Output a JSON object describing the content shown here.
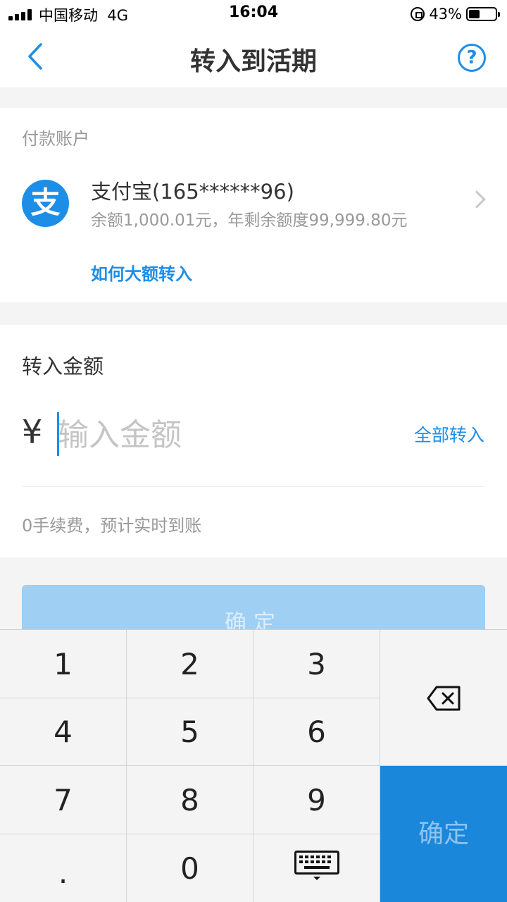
{
  "status_bar": {
    "carrier": "中国移动",
    "network": "4G",
    "time": "16:04",
    "battery_text": "43%",
    "battery_level": 0.43
  },
  "nav": {
    "title": "转入到活期",
    "help_symbol": "?"
  },
  "payment": {
    "section_label": "付款账户",
    "logo_char": "支",
    "account_name": "支付宝(165******96)",
    "balance_text": "余额1,000.01元，年剩余额度99,999.80元",
    "large_transfer_link": "如何大额转入"
  },
  "amount": {
    "section_label": "转入金额",
    "currency_symbol": "¥",
    "input_placeholder": "输入金额",
    "input_value": "",
    "transfer_all_label": "全部转入",
    "fee_note": "0手续费，预计实时到账"
  },
  "confirm_button": {
    "label": "确定"
  },
  "keyboard": {
    "keys": [
      "1",
      "2",
      "3",
      "4",
      "5",
      "6",
      "7",
      "8",
      "9",
      ".",
      "0"
    ],
    "ok_label": "确定"
  },
  "colors": {
    "accent": "#1c8ee8",
    "confirm_disabled": "#9fcff3",
    "keyboard_ok": "#1a87da",
    "page_background": "#f4f4f4"
  }
}
